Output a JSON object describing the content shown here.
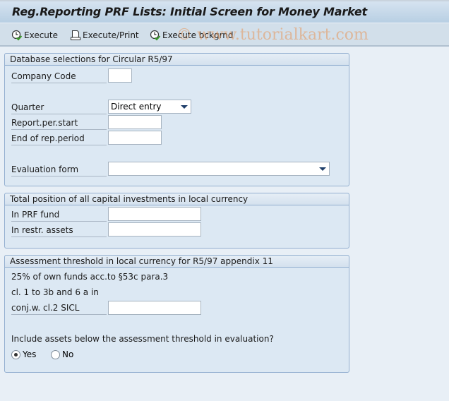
{
  "title": "Reg.Reporting PRF Lists: Initial Screen for Money Market",
  "toolbar": {
    "execute": {
      "label": "Execute",
      "icon": "execute-clock-icon"
    },
    "execute_print": {
      "label": "Execute/Print",
      "icon": "print-icon"
    },
    "execute_background": {
      "label": "Execute bckgrnd",
      "icon": "execute-clock-icon"
    }
  },
  "watermark": "© www.tutorialkart.com",
  "groups": {
    "database": {
      "title": "Database selections for Circular R5/97",
      "company_code": {
        "label": "Company Code",
        "value": ""
      },
      "quarter": {
        "label": "Quarter",
        "value": "Direct entry"
      },
      "report_start": {
        "label": "Report.per.start",
        "value": ""
      },
      "report_end": {
        "label": "End of rep.period",
        "value": ""
      },
      "evaluation_form": {
        "label": "Evaluation form",
        "value": ""
      }
    },
    "total_position": {
      "title": "Total position of all capital investments in local currency",
      "prf_fund": {
        "label": "In PRF fund",
        "value": ""
      },
      "restr_assets": {
        "label": "In restr. assets",
        "value": ""
      }
    },
    "threshold": {
      "title": "Assessment threshold in local currency for R5/97 appendix 11",
      "line1": "25% of own funds acc.to §53c para.3",
      "line2": "cl. 1 to 3b and 6 a in",
      "sicl": {
        "label": "conj.w. cl.2 SICL",
        "value": ""
      },
      "question": "Include assets below the assessment threshold in evaluation?",
      "options": [
        {
          "label": "Yes",
          "selected": true
        },
        {
          "label": "No",
          "selected": false
        }
      ]
    }
  },
  "colors": {
    "background": "#e8eff6",
    "group_background": "#dce8f3",
    "group_border": "#93afd0",
    "toolbar": "#d2dfea",
    "title_bar": "#c4d7ea"
  }
}
